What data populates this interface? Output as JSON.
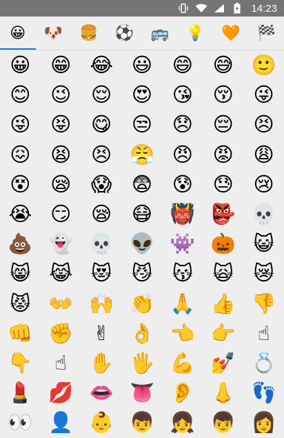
{
  "status": {
    "time": "14:23"
  },
  "tabs": [
    {
      "name": "tab-smileys",
      "icon": "😀",
      "active": true
    },
    {
      "name": "tab-animals",
      "icon": "🐶",
      "active": false
    },
    {
      "name": "tab-food",
      "icon": "🍔",
      "active": false
    },
    {
      "name": "tab-activity",
      "icon": "⚽",
      "active": false
    },
    {
      "name": "tab-travel",
      "icon": "🚌",
      "active": false
    },
    {
      "name": "tab-objects",
      "icon": "💡",
      "active": false
    },
    {
      "name": "tab-symbols",
      "icon": "🧡",
      "active": false
    },
    {
      "name": "tab-flags",
      "icon": "🏁",
      "active": false
    }
  ],
  "emojis": [
    "😀",
    "😁",
    "😂",
    "😃",
    "😄",
    "😅",
    "🙂",
    "😊",
    "😉",
    "😌",
    "😍",
    "😘",
    "😚",
    "😜",
    "😜",
    "😝",
    "😋",
    "😒",
    "😞",
    "😔",
    "😣",
    "😖",
    "😫",
    "😣",
    "😤",
    "😠",
    "😡",
    "😩",
    "😵",
    "😪",
    "😱",
    "😨",
    "😰",
    "😓",
    "😢",
    "😭",
    "😏",
    "😪",
    "😷",
    "👹",
    "👺",
    "💀",
    "💩",
    "👻",
    "💀",
    "👽",
    "👾",
    "🎃",
    "😺",
    "😸",
    "😹",
    "😻",
    "😼",
    "😽",
    "🙀",
    "😿",
    "😾",
    "👐",
    "🙌",
    "👏",
    "🙏",
    "👍",
    "👎",
    "👊",
    "✊",
    "✌",
    "👌",
    "👈",
    "👉",
    "☝",
    "👇",
    "☝",
    "✋",
    "🖐",
    "💪",
    "💅",
    "💍",
    "💄",
    "💋",
    "👄",
    "👅",
    "👂",
    "👃",
    "👣",
    "👀",
    "👤",
    "👶",
    "👦",
    "👧",
    "👦",
    "👩"
  ]
}
